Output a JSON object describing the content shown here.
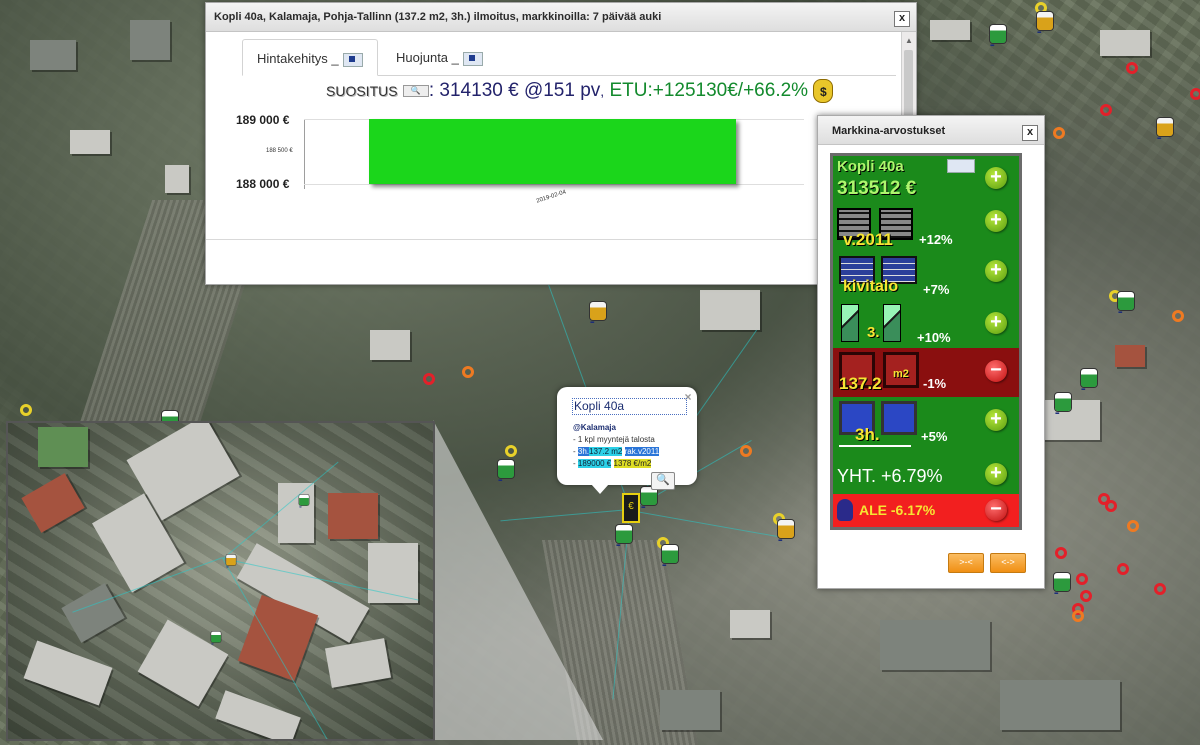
{
  "listing_dialog": {
    "title": "Kopli 40a, Kalamaja, Pohja-Tallinn (137.2 m2, 3h.) ilmoitus, markkinoilla: 7 päivää auki",
    "close": "x",
    "tabs": [
      {
        "label": "Hintakehitys _",
        "active": true
      },
      {
        "label": "Huojunta _",
        "active": false
      }
    ],
    "recommendation": {
      "label": "SUOSITUS",
      "separator": ":",
      "price": "314130 € @151 pv",
      "comma": ",",
      "etu": "ETU:+125130€/+66.2%"
    }
  },
  "chart_data": {
    "type": "bar",
    "categories": [
      "2019-02-04"
    ],
    "values": [
      189000
    ],
    "ylim": [
      188000,
      189000
    ],
    "yticks": [
      "189 000 €",
      "188 500 €",
      "188 000 €"
    ],
    "bar_color": "#1bd61b"
  },
  "market_panel": {
    "title": "Markkina-arvostukset",
    "close": "x",
    "address": "Kopli 40a",
    "estimate": "313512 €",
    "factors": [
      {
        "label": "v.2011",
        "pct": "+12%",
        "sign": "+"
      },
      {
        "label": "kivitalo",
        "pct": "+7%",
        "sign": "+"
      },
      {
        "label": "3.",
        "pct": "+10%",
        "sign": "+"
      },
      {
        "label": "137.2",
        "unit": "m2",
        "pct": "-1%",
        "sign": "-"
      },
      {
        "label": "3h.",
        "pct": "+5%",
        "sign": "+"
      }
    ],
    "total": "YHT. +6.79%",
    "discount": "ALE -6.17%",
    "buttons": [
      ">-<",
      "<->"
    ]
  },
  "map_popup": {
    "title": "Kopli 40a",
    "area": "@Kalamaja",
    "line1": "- 1 kpl myyntejä talosta",
    "line2_prefix": "- ",
    "rooms": "3h.",
    "size": "137.2 m2",
    "year": "rak.v2011",
    "price": "189000 €",
    "price_m2": "1378 €/m2",
    "close": "×"
  },
  "colors": {
    "panel_green": "#1b8a1b",
    "panel_red": "#8a0f0f",
    "alert_red": "#f21f1f",
    "highlight_yellow": "#f7e533"
  }
}
